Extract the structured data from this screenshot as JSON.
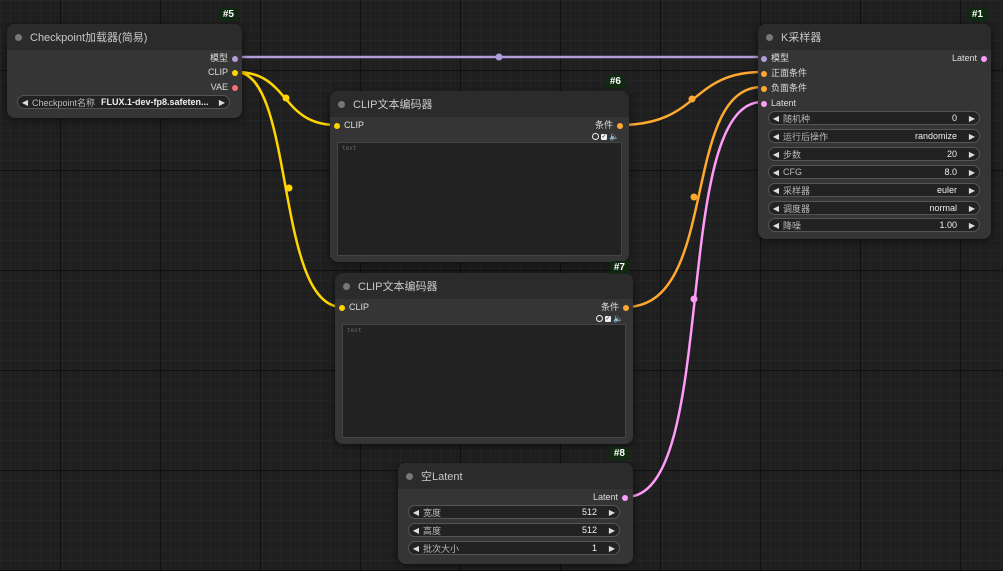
{
  "colors": {
    "model": "#b39ddb",
    "clip": "#ffd500",
    "vae": "#ff6e6e",
    "conditioning": "#ffa931",
    "latent": "#ff9cf9"
  },
  "nodes": {
    "checkpoint": {
      "id": "#5",
      "title": "Checkpoint加载器(简易)",
      "outputs": [
        "模型",
        "CLIP",
        "VAE"
      ],
      "widget": {
        "label": "Checkpoint名称",
        "value": "FLUX.1-dev-fp8.safeten..."
      }
    },
    "clip_pos": {
      "id": "#6",
      "title": "CLIP文本编码器",
      "input": "CLIP",
      "output": "条件",
      "placeholder": "text"
    },
    "clip_neg": {
      "id": "#7",
      "title": "CLIP文本编码器",
      "input": "CLIP",
      "output": "条件",
      "placeholder": "text"
    },
    "ksampler": {
      "id": "#1",
      "title": "K采样器",
      "inputs": [
        "模型",
        "正面条件",
        "负面条件",
        "Latent"
      ],
      "output": "Latent",
      "widgets": [
        {
          "label": "随机种",
          "value": "0"
        },
        {
          "label": "运行后操作",
          "value": "randomize"
        },
        {
          "label": "步数",
          "value": "20"
        },
        {
          "label": "CFG",
          "value": "8.0"
        },
        {
          "label": "采样器",
          "value": "euler"
        },
        {
          "label": "调度器",
          "value": "normal"
        },
        {
          "label": "降噪",
          "value": "1.00"
        }
      ]
    },
    "empty_latent": {
      "id": "#8",
      "title": "空Latent",
      "output": "Latent",
      "widgets": [
        {
          "label": "宽度",
          "value": "512"
        },
        {
          "label": "高度",
          "value": "512"
        },
        {
          "label": "批次大小",
          "value": "1"
        }
      ]
    }
  }
}
